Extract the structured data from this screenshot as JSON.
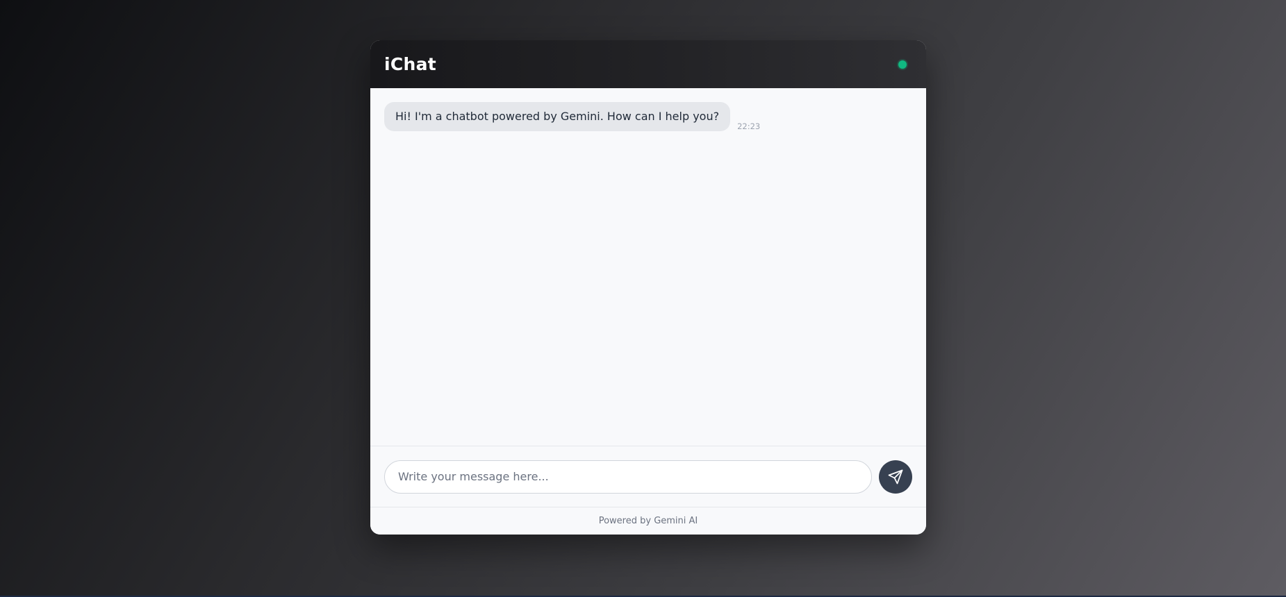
{
  "app": {
    "title": "iChat",
    "status": "online",
    "status_color": "#10b981"
  },
  "messages": [
    {
      "sender": "bot",
      "text": "Hi! I'm a chatbot powered by Gemini. How can I help you?",
      "time": "22:23"
    }
  ],
  "composer": {
    "placeholder": "Write your message here...",
    "value": "",
    "send_icon": "send-icon"
  },
  "footer": {
    "text": "Powered by Gemini AI"
  },
  "colors": {
    "header_bg": "#1c1c1f",
    "send_button": "#374151",
    "bot_bubble": "#e5e7eb"
  }
}
